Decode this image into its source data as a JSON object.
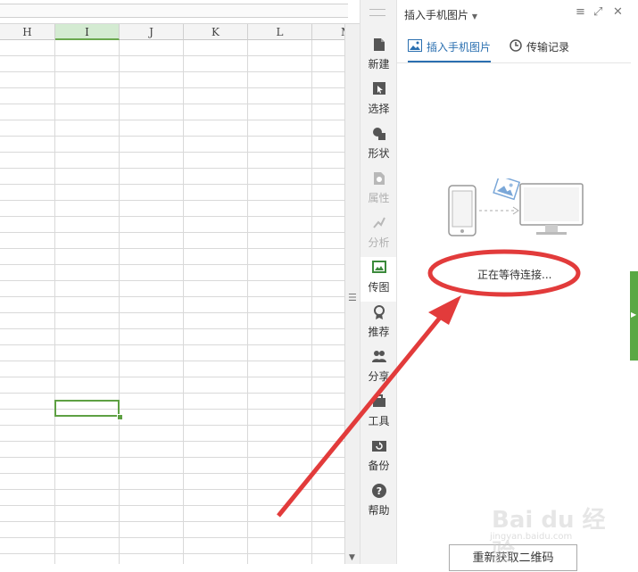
{
  "spreadsheet": {
    "columns": [
      "H",
      "I",
      "J",
      "K",
      "L",
      "M"
    ],
    "selected_column": "I"
  },
  "toolbar": {
    "items": [
      {
        "label": "新建",
        "icon": "file-icon",
        "state": "normal"
      },
      {
        "label": "选择",
        "icon": "select-icon",
        "state": "normal"
      },
      {
        "label": "形状",
        "icon": "shape-icon",
        "state": "normal"
      },
      {
        "label": "属性",
        "icon": "properties-icon",
        "state": "disabled"
      },
      {
        "label": "分析",
        "icon": "analyze-icon",
        "state": "disabled"
      },
      {
        "label": "传图",
        "icon": "upload-image-icon",
        "state": "active"
      },
      {
        "label": "推荐",
        "icon": "recommend-icon",
        "state": "normal"
      },
      {
        "label": "分享",
        "icon": "share-icon",
        "state": "normal"
      },
      {
        "label": "工具",
        "icon": "tools-icon",
        "state": "normal"
      },
      {
        "label": "备份",
        "icon": "backup-icon",
        "state": "normal"
      },
      {
        "label": "帮助",
        "icon": "help-icon",
        "state": "normal"
      }
    ]
  },
  "panel": {
    "title": "插入手机图片",
    "tabs": [
      {
        "label": "插入手机图片",
        "active": true
      },
      {
        "label": "传输记录",
        "active": false
      }
    ],
    "status_text": "正在等待连接...",
    "refresh_button": "重新获取二维码"
  },
  "watermark": {
    "brand": "Bai du 经验",
    "url": "jingyan.baidu.com"
  },
  "colors": {
    "accent_green": "#5ea043",
    "tab_active": "#2a6fb0",
    "annotation_red": "#e23b3b"
  }
}
